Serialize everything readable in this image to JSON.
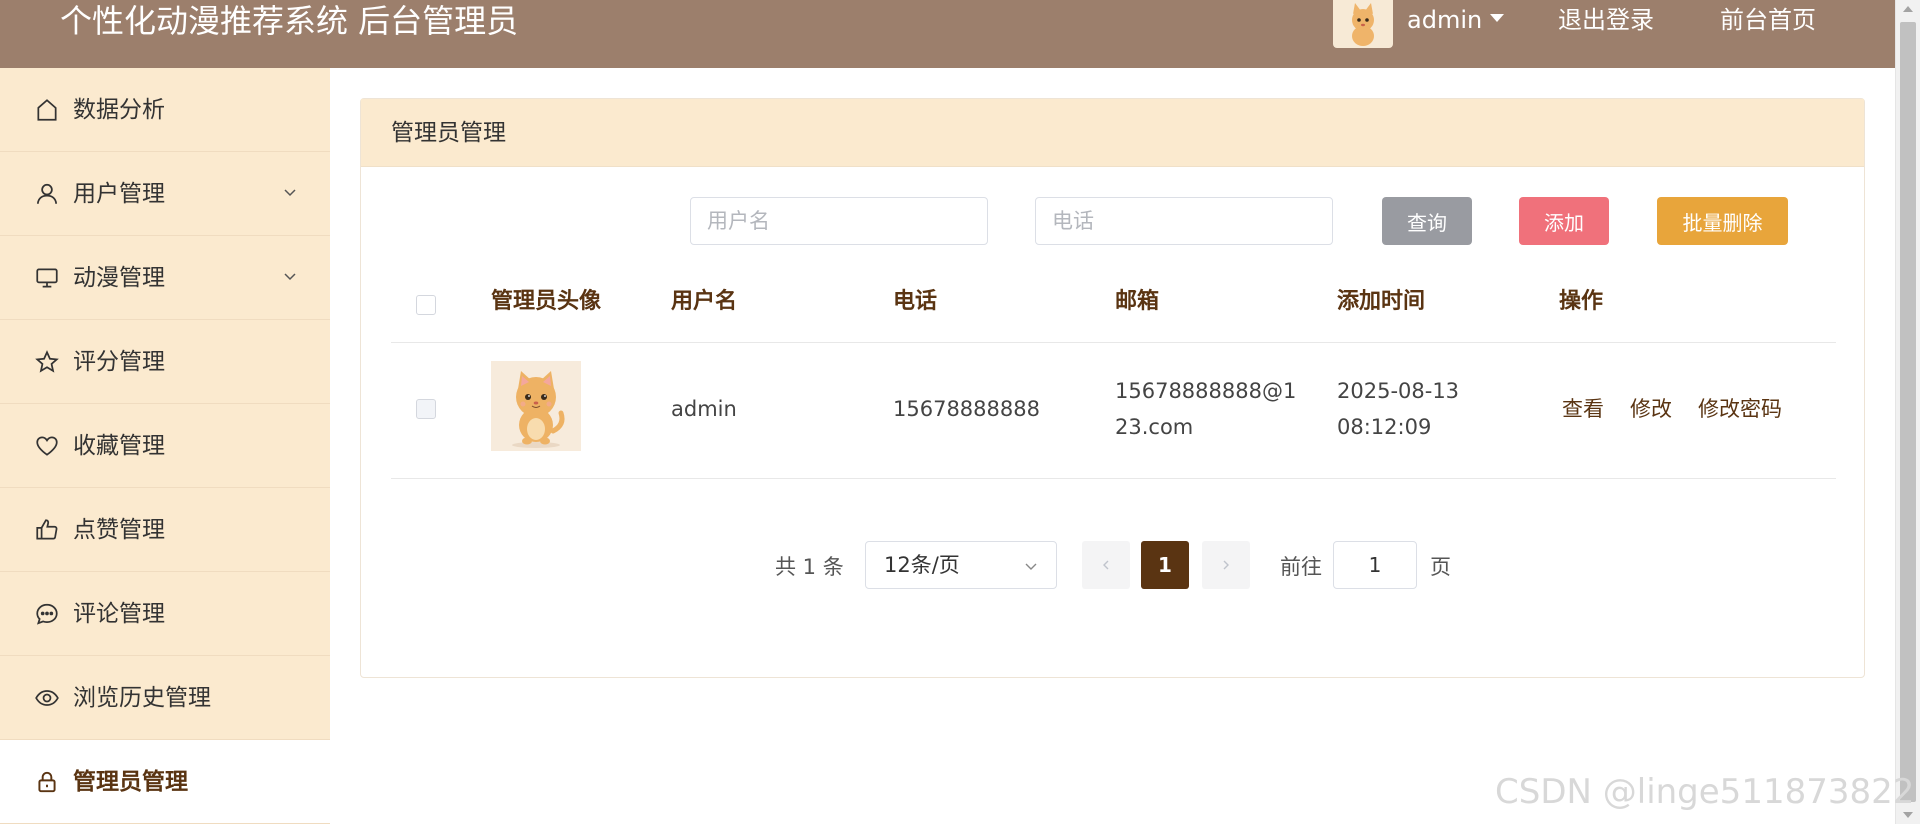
{
  "header": {
    "title": "个性化动漫推荐系统 后台管理员",
    "username": "admin",
    "logout": "退出登录",
    "front_home": "前台首页"
  },
  "sidebar": {
    "items": [
      {
        "label": "数据分析",
        "icon": "home-icon"
      },
      {
        "label": "用户管理",
        "icon": "user-icon",
        "expandable": true
      },
      {
        "label": "动漫管理",
        "icon": "monitor-icon",
        "expandable": true
      },
      {
        "label": "评分管理",
        "icon": "star-icon"
      },
      {
        "label": "收藏管理",
        "icon": "heart-icon"
      },
      {
        "label": "点赞管理",
        "icon": "thumb-up-icon"
      },
      {
        "label": "评论管理",
        "icon": "chat-bubble-icon"
      },
      {
        "label": "浏览历史管理",
        "icon": "eye-icon"
      },
      {
        "label": "管理员管理",
        "icon": "lock-icon",
        "active": true
      }
    ]
  },
  "panel": {
    "title": "管理员管理"
  },
  "search": {
    "username_placeholder": "用户名",
    "phone_placeholder": "电话",
    "query_label": "查询",
    "add_label": "添加",
    "batch_delete_label": "批量删除"
  },
  "table": {
    "columns": [
      "管理员头像",
      "用户名",
      "电话",
      "邮箱",
      "添加时间",
      "操作"
    ],
    "rows": [
      {
        "username": "admin",
        "phone": "15678888888",
        "email_line1": "15678888888@1",
        "email_line2": "23.com",
        "time_line1": "2025-08-13",
        "time_line2": "08:12:09",
        "actions": [
          "查看",
          "修改",
          "修改密码"
        ]
      }
    ]
  },
  "pagination": {
    "total": "共 1 条",
    "page_size": "12条/页",
    "current_page": "1",
    "goto_label": "前往",
    "goto_value": "1",
    "page_suffix": "页"
  },
  "watermark": "CSDN @linge511873822",
  "colors": {
    "header_bg": "#9c7f6c",
    "sidebar_bg": "#fbeacf",
    "accent_brown": "#5a3412",
    "btn_query": "#999ba1",
    "btn_add": "#f0717b",
    "btn_batch": "#e8a53b"
  }
}
